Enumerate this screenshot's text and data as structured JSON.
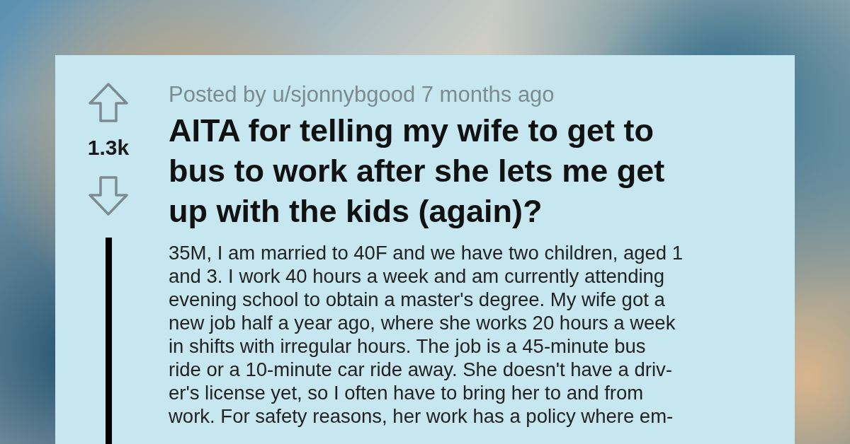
{
  "post": {
    "votes": "1.3k",
    "byline": "Posted by u/sjonnybgood 7 months ago",
    "title": "AITA for telling my wife to get to\nbus to work after she lets me get\nup with the kids (again)?",
    "body": "35M, I am married to 40F and we have two children, aged 1\nand 3. I work 40 hours a week and am currently attending\nevening school to obtain a master's degree. My wife got a\nnew job half a year ago, where she works 20 hours a week\nin shifts with irregular hours. The job is a 45-minute bus\nride or a 10-minute car ride away. She doesn't have a driv-\ner's license yet, so I often have to bring her to and from\nwork. For safety reasons, her work has a policy where em-"
  }
}
